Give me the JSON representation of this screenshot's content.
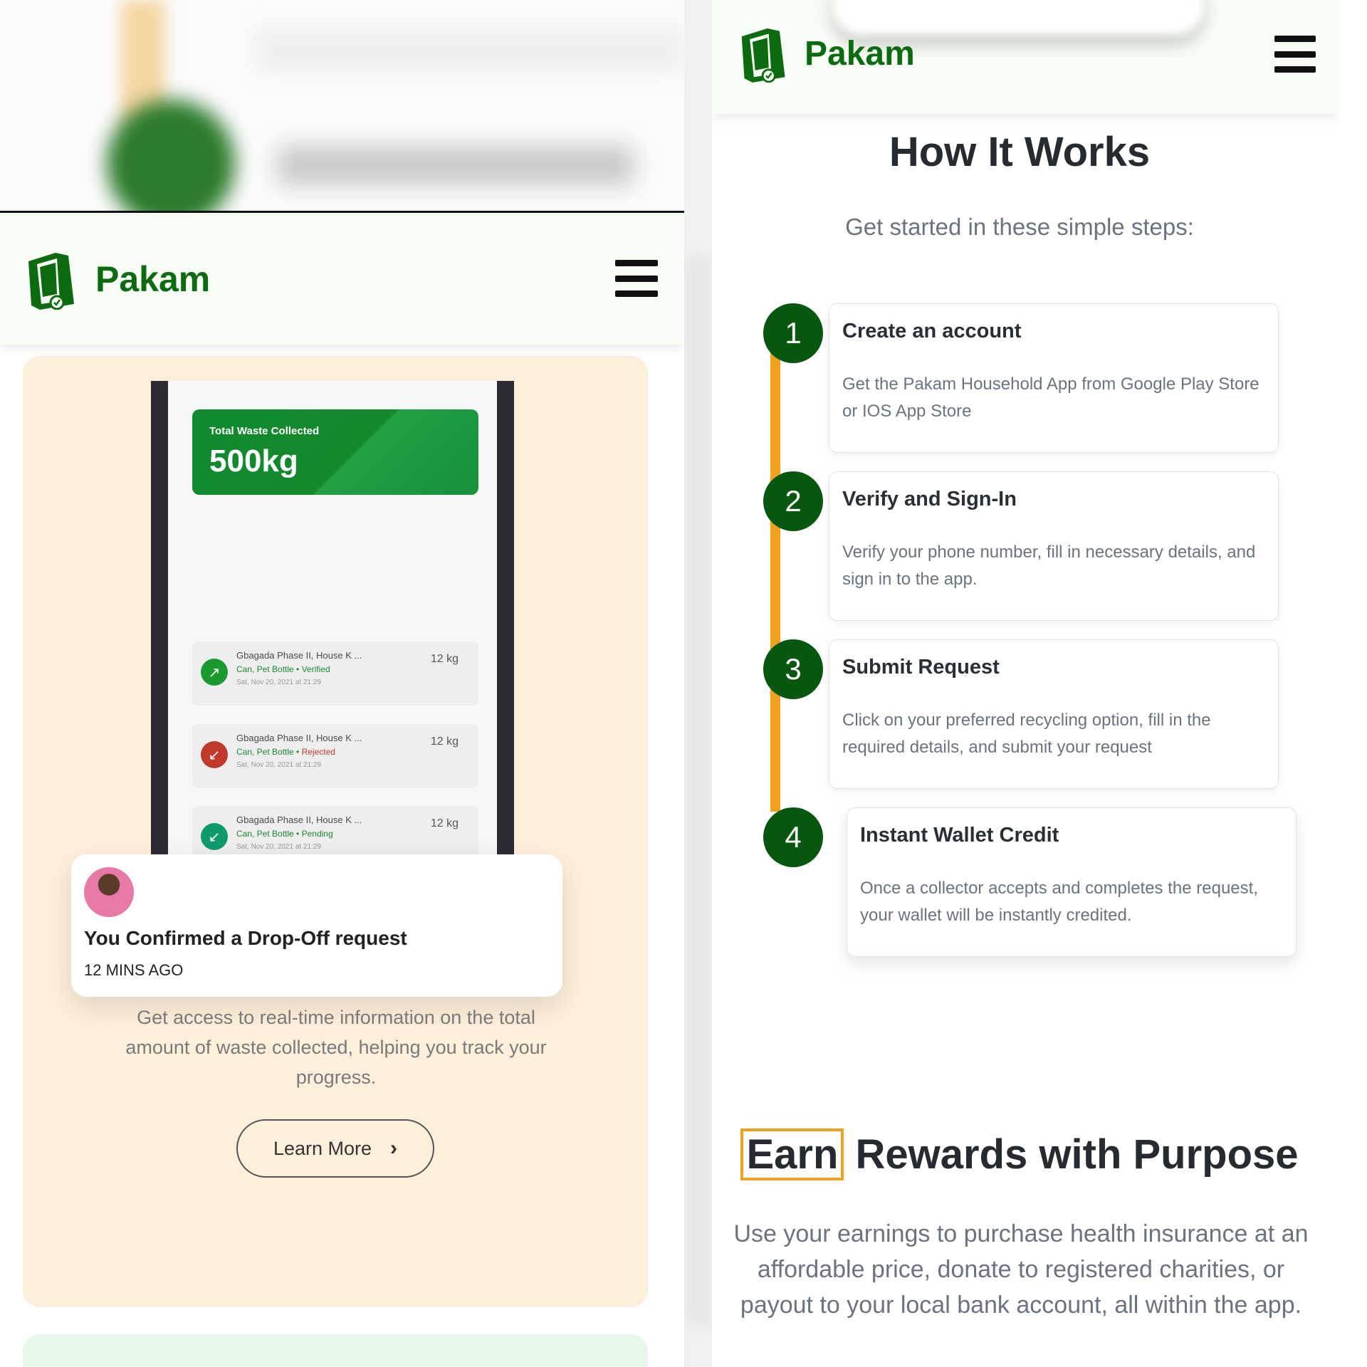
{
  "brand": {
    "name": "Pakam",
    "color": "#0c6b10"
  },
  "left": {
    "feature": {
      "waste_label": "Total Waste Collected",
      "waste_value": "500kg",
      "transactions": [
        {
          "title": "Gbagada Phase II, House K ...",
          "items": "Can, Pet Bottle",
          "status": "Verified",
          "status_color": "#1b8a2f",
          "date": "Sat, Nov 20, 2021 at 21:29",
          "kg": "12 kg",
          "icon": "arrow-up-right-icon",
          "icon_color": "#1a9a2e"
        },
        {
          "title": "Gbagada Phase II, House K ...",
          "items": "Can, Pet Bottle",
          "status": "Rejected",
          "status_color": "#c0392b",
          "date": "Sat, Nov 20, 2021 at 21:29",
          "kg": "12 kg",
          "icon": "arrow-down-left-icon",
          "icon_color": "#c0392b"
        },
        {
          "title": "Gbagada Phase II, House K ...",
          "items": "Can, Pet Bottle",
          "status": "Pending",
          "status_color": "#1b8a2f",
          "date": "Sat, Nov 20, 2021 at 21:29",
          "kg": "12 kg",
          "icon": "arrow-down-left-icon",
          "icon_color": "#0f9a6e"
        }
      ],
      "notification": {
        "title": "You Confirmed a Drop-Off request",
        "time": "12 MINS AGO"
      },
      "description": "Get access to real-time information on the total amount of waste collected, helping you track your progress.",
      "learn_more": "Learn More"
    }
  },
  "right": {
    "how_title": "How It Works",
    "how_subtitle": "Get started in these simple steps:",
    "steps": [
      {
        "number": "1",
        "title": "Create an account",
        "desc": "Get the Pakam Household App from Google Play Store or IOS App Store"
      },
      {
        "number": "2",
        "title": "Verify and Sign-In",
        "desc": "Verify your phone number, fill in necessary details, and sign in to the app."
      },
      {
        "number": "3",
        "title": "Submit Request",
        "desc": "Click on your preferred recycling option, fill in the required details, and submit your request"
      },
      {
        "number": "4",
        "title": "Instant Wallet Credit",
        "desc": "Once a collector accepts and completes the request, your wallet will be instantly credited."
      }
    ],
    "earn_highlight": "Earn",
    "earn_rest": "Rewards with Purpose",
    "earn_desc": "Use your earnings to purchase health insurance at an affordable price, donate to registered charities, or payout to your local bank account, all within the app.",
    "accent_color": "#f0a21f",
    "step_color": "#07570f"
  }
}
